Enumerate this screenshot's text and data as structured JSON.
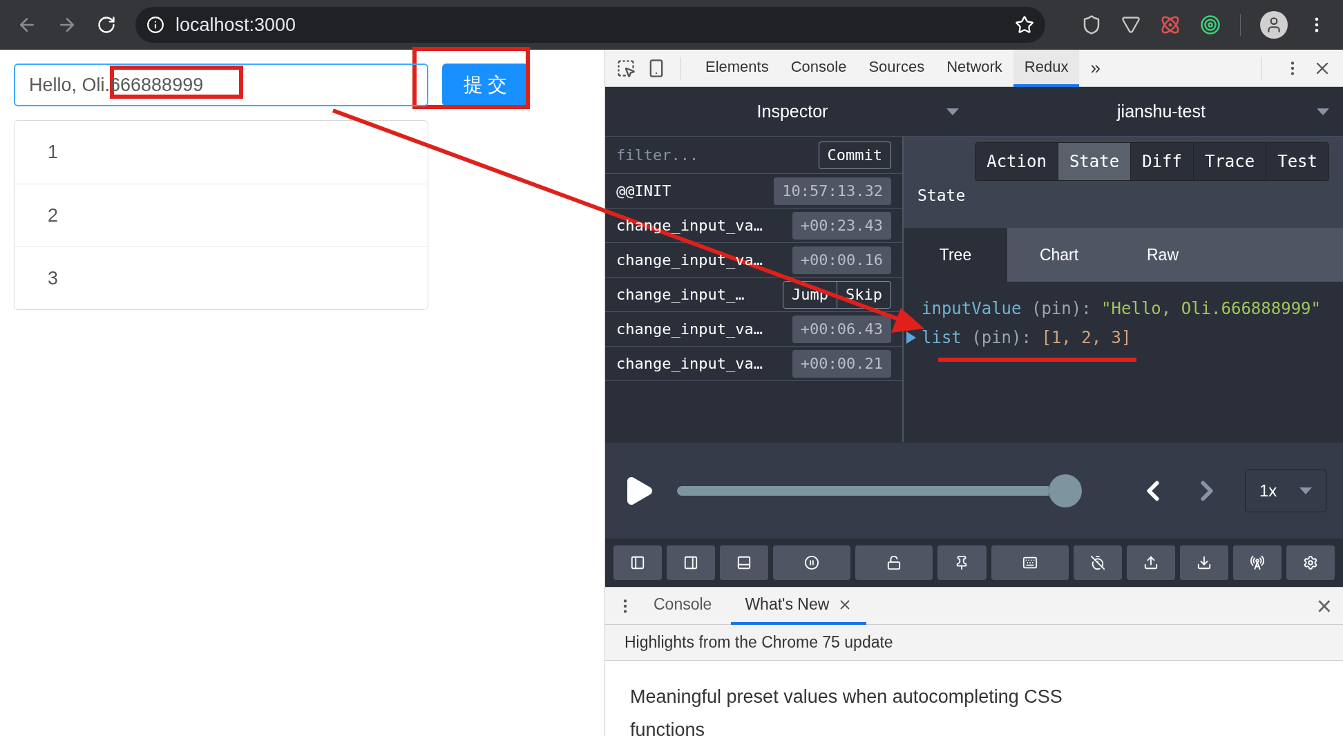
{
  "browser": {
    "url": "localhost:3000"
  },
  "page": {
    "input": {
      "value": "Hello, Oli.666888999"
    },
    "submit": "提 交",
    "list": [
      "1",
      "2",
      "3"
    ]
  },
  "devtools": {
    "tabs": [
      {
        "label": "Elements",
        "selected": false
      },
      {
        "label": "Console",
        "selected": false
      },
      {
        "label": "Sources",
        "selected": false
      },
      {
        "label": "Network",
        "selected": false
      },
      {
        "label": "Redux",
        "selected": true
      }
    ],
    "more": "»",
    "redux": {
      "monitor": "Inspector",
      "store": "jianshu-test",
      "filter": {
        "placeholder": "filter..."
      },
      "commit": "Commit",
      "actions": [
        {
          "kind": "plain",
          "name": "@@INIT",
          "time": "10:57:13.32"
        },
        {
          "kind": "plain",
          "name": "change_input_va…",
          "time": "+00:23.43"
        },
        {
          "kind": "plain",
          "name": "change_input_va…",
          "time": "+00:00.16"
        },
        {
          "kind": "hovered",
          "name": "change_input_…",
          "buttons": [
            "Jump",
            "Skip"
          ]
        },
        {
          "kind": "plain",
          "name": "change_input_va…",
          "time": "+00:06.43"
        },
        {
          "kind": "plain",
          "name": "change_input_va…",
          "time": "+00:00.21"
        }
      ],
      "tabs": [
        {
          "label": "Action",
          "selected": false
        },
        {
          "label": "State",
          "selected": true
        },
        {
          "label": "Diff",
          "selected": false
        },
        {
          "label": "Trace",
          "selected": false
        },
        {
          "label": "Test",
          "selected": false
        }
      ],
      "heading": "State",
      "subtabs": [
        {
          "label": "Tree",
          "selected": true
        },
        {
          "label": "Chart",
          "selected": false
        },
        {
          "label": "Raw",
          "selected": false
        }
      ],
      "tree": [
        {
          "kind": "string",
          "key": "inputValue",
          "note": "(pin):",
          "value": "\"Hello, Oli.666888999\""
        },
        {
          "kind": "array",
          "key": "list",
          "note": "(pin):",
          "value": "[1, 2, 3]",
          "expanded": false
        }
      ],
      "slider": {
        "level": 1
      },
      "speed": "1x"
    }
  },
  "drawer": {
    "tabs": [
      {
        "label": "Console",
        "selected": false,
        "closable": false
      },
      {
        "label": "What's New",
        "selected": true,
        "closable": true
      }
    ],
    "close": "×",
    "highlight": "Highlights from the Chrome 75 update",
    "article": "Meaningful preset values when autocompleting CSS functions"
  }
}
